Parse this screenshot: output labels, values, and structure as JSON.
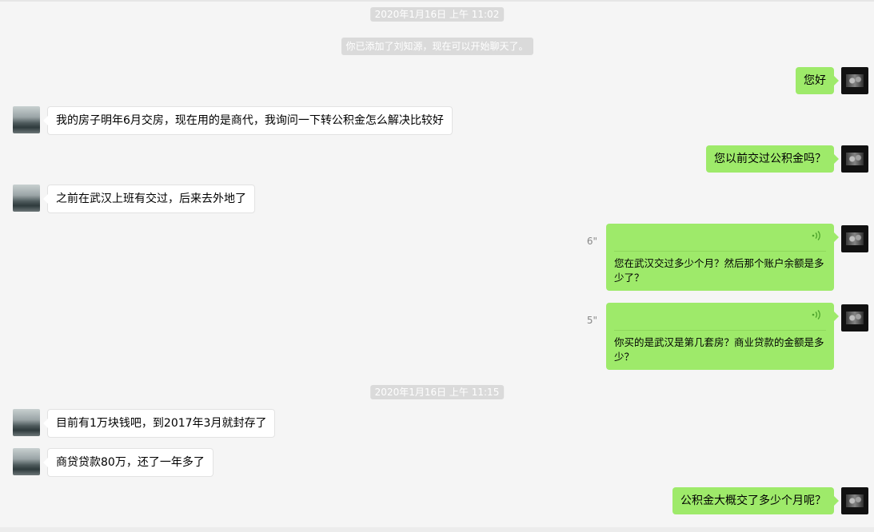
{
  "timestamps": [
    "2020年1月16日 上午 11:02",
    "2020年1月16日 上午 11:15"
  ],
  "system_notice": "你已添加了刘知源，现在可以开始聊天了。",
  "messages": [
    {
      "side": "right",
      "type": "text",
      "text": "您好"
    },
    {
      "side": "left",
      "type": "text",
      "text": "我的房子明年6月交房，现在用的是商代，我询问一下转公积金怎么解决比较好"
    },
    {
      "side": "right",
      "type": "text",
      "text": "您以前交过公积金吗？"
    },
    {
      "side": "left",
      "type": "text",
      "text": "之前在武汉上班有交过，后来去外地了"
    },
    {
      "side": "right",
      "type": "voice",
      "duration": "6\"",
      "text": "您在武汉交过多少个月？然后那个账户余额是多少了？"
    },
    {
      "side": "right",
      "type": "voice",
      "duration": "5\"",
      "text": "你买的是武汉是第几套房？商业贷款的金额是多少？"
    },
    {
      "side": "left",
      "type": "text",
      "text": "目前有1万块钱吧，到2017年3月就封存了"
    },
    {
      "side": "left",
      "type": "text",
      "text": "商贷贷款80万，还了一年多了"
    },
    {
      "side": "right",
      "type": "text",
      "text": "公积金大概交了多少个月呢？"
    }
  ],
  "icons": {
    "voice_wave": "voice-wave-icon",
    "peer_avatar": "peer-avatar",
    "self_avatar": "self-avatar"
  },
  "colors": {
    "self_bubble": "#9eea6a",
    "peer_bubble": "#ffffff",
    "background": "#f5f5f5",
    "timestamp_bg": "#dadada"
  }
}
